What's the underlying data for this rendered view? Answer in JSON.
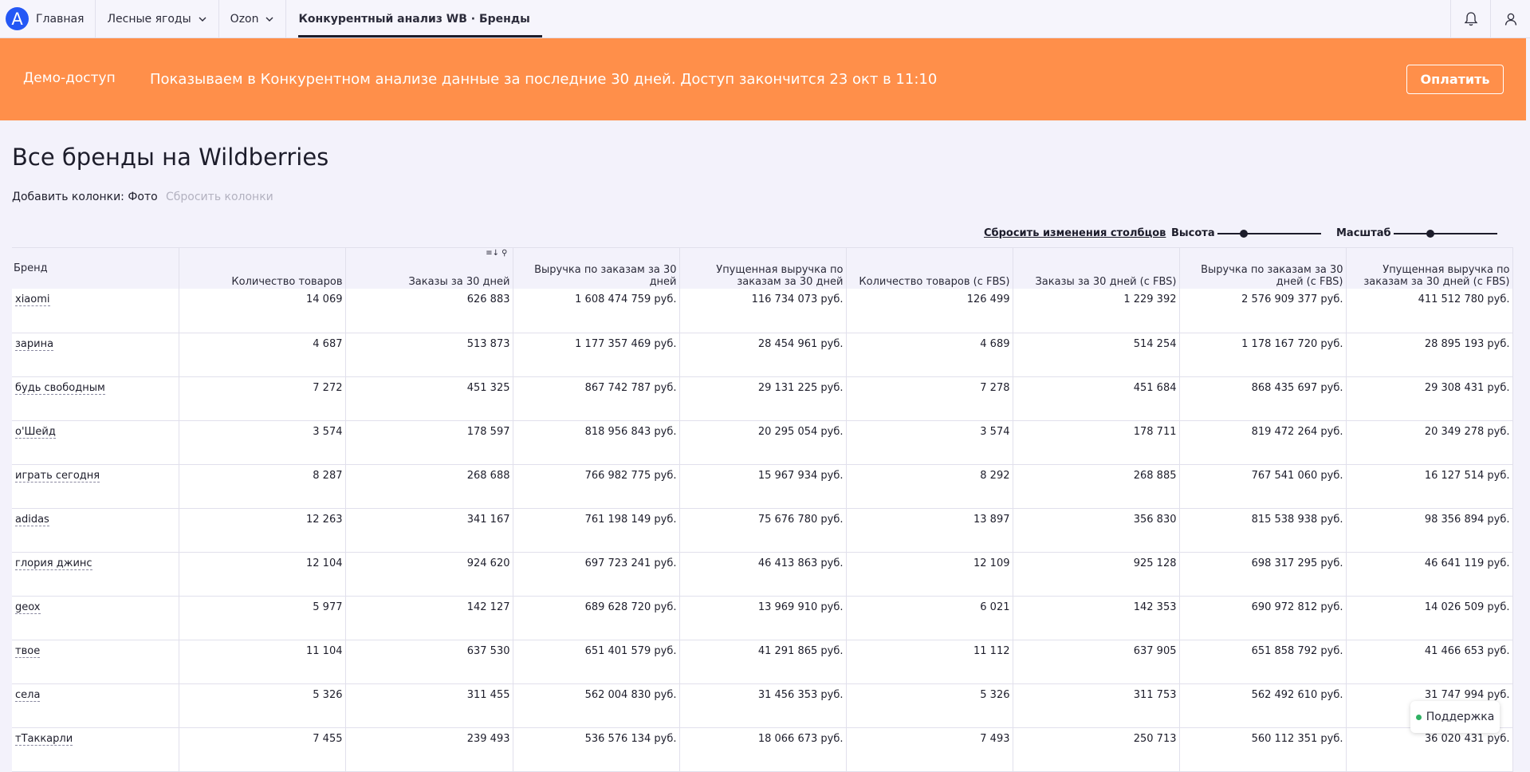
{
  "nav": {
    "logo_letter": "A",
    "home": "Главная",
    "project": "Лесные ягоды",
    "marketplace": "Ozon",
    "active_tab": "Конкурентный анализ WB · Бренды",
    "right_icons": [
      "bell-icon",
      "user-icon"
    ]
  },
  "banner": {
    "label": "Демо-доступ",
    "text": "Показываем в Конкурентном анализе данные за последние 30 дней. Доступ закончится 23 окт в 11:10",
    "button": "Оплатить",
    "color": "#ff8f4a"
  },
  "page": {
    "title": "Все бренды на Wildberries",
    "add_columns_label": "Добавить колонки:",
    "add_columns_option": "Фото",
    "reset_columns": "Сбросить колонки"
  },
  "toolbar": {
    "reset_changes": "Сбросить изменения столбцов",
    "height_label": "Высота",
    "height_level": 0.25,
    "scale_label": "Масштаб",
    "scale_level": 0.35
  },
  "table": {
    "headers": [
      "Бренд",
      "Количество товаров",
      "Заказы за 30 дней",
      "Выручка по заказам за 30 дней",
      "Упущенная выручка по заказам за 30 дней",
      "Количество товаров (с FBS)",
      "Заказы за 30 дней (с FBS)",
      "Выручка по заказам за 30 дней (с FBS)",
      "Упущенная выручка по заказам за 30 дней (с FBS)"
    ],
    "rows": [
      [
        "xiaomi",
        "14 069",
        "626 883",
        "1 608 474 759 руб.",
        "116 734 073 руб.",
        "126 499",
        "1 229 392",
        "2 576 909 377 руб.",
        "411 512 780 руб."
      ],
      [
        "зарина",
        "4 687",
        "513 873",
        "1 177 357 469 руб.",
        "28 454 961 руб.",
        "4 689",
        "514 254",
        "1 178 167 720 руб.",
        "28 895 193 руб."
      ],
      [
        "будь свободным",
        "7 272",
        "451 325",
        "867 742 787 руб.",
        "29 131 225 руб.",
        "7 278",
        "451 684",
        "868 435 697 руб.",
        "29 308 431 руб."
      ],
      [
        "о'Шейд",
        "3 574",
        "178 597",
        "818 956 843 руб.",
        "20 295 054 руб.",
        "3 574",
        "178 711",
        "819 472 264 руб.",
        "20 349 278 руб."
      ],
      [
        "играть сегодня",
        "8 287",
        "268 688",
        "766 982 775 руб.",
        "15 967 934 руб.",
        "8 292",
        "268 885",
        "767 541 060 руб.",
        "16 127 514 руб."
      ],
      [
        "adidas",
        "12 263",
        "341 167",
        "761 198 149 руб.",
        "75 676 780 руб.",
        "13 897",
        "356 830",
        "815 538 938 руб.",
        "98 356 894 руб."
      ],
      [
        "глория джинс",
        "12 104",
        "924 620",
        "697 723 241 руб.",
        "46 413 863 руб.",
        "12 109",
        "925 128",
        "698 317 295 руб.",
        "46 641 119 руб."
      ],
      [
        "geox",
        "5 977",
        "142 127",
        "689 628 720 руб.",
        "13 969 910 руб.",
        "6 021",
        "142 353",
        "690 972 812 руб.",
        "14 026 509 руб."
      ],
      [
        "твое",
        "11 104",
        "637 530",
        "651 401 579 руб.",
        "41 291 865 руб.",
        "11 112",
        "637 905",
        "651 858 792 руб.",
        "41 466 653 руб."
      ],
      [
        "села",
        "5 326",
        "311 455",
        "562 004 830 руб.",
        "31 456 353 руб.",
        "5 326",
        "311 753",
        "562 492 610 руб.",
        "31 747 994 руб."
      ],
      [
        "тТаккарли",
        "7 455",
        "239 493",
        "536 576 134 руб.",
        "18 066 673 руб.",
        "7 493",
        "250 713",
        "560 112 351 руб.",
        "36 020 431 руб."
      ]
    ]
  },
  "support": {
    "label": "Поддержка",
    "status_color": "#2fb163"
  }
}
